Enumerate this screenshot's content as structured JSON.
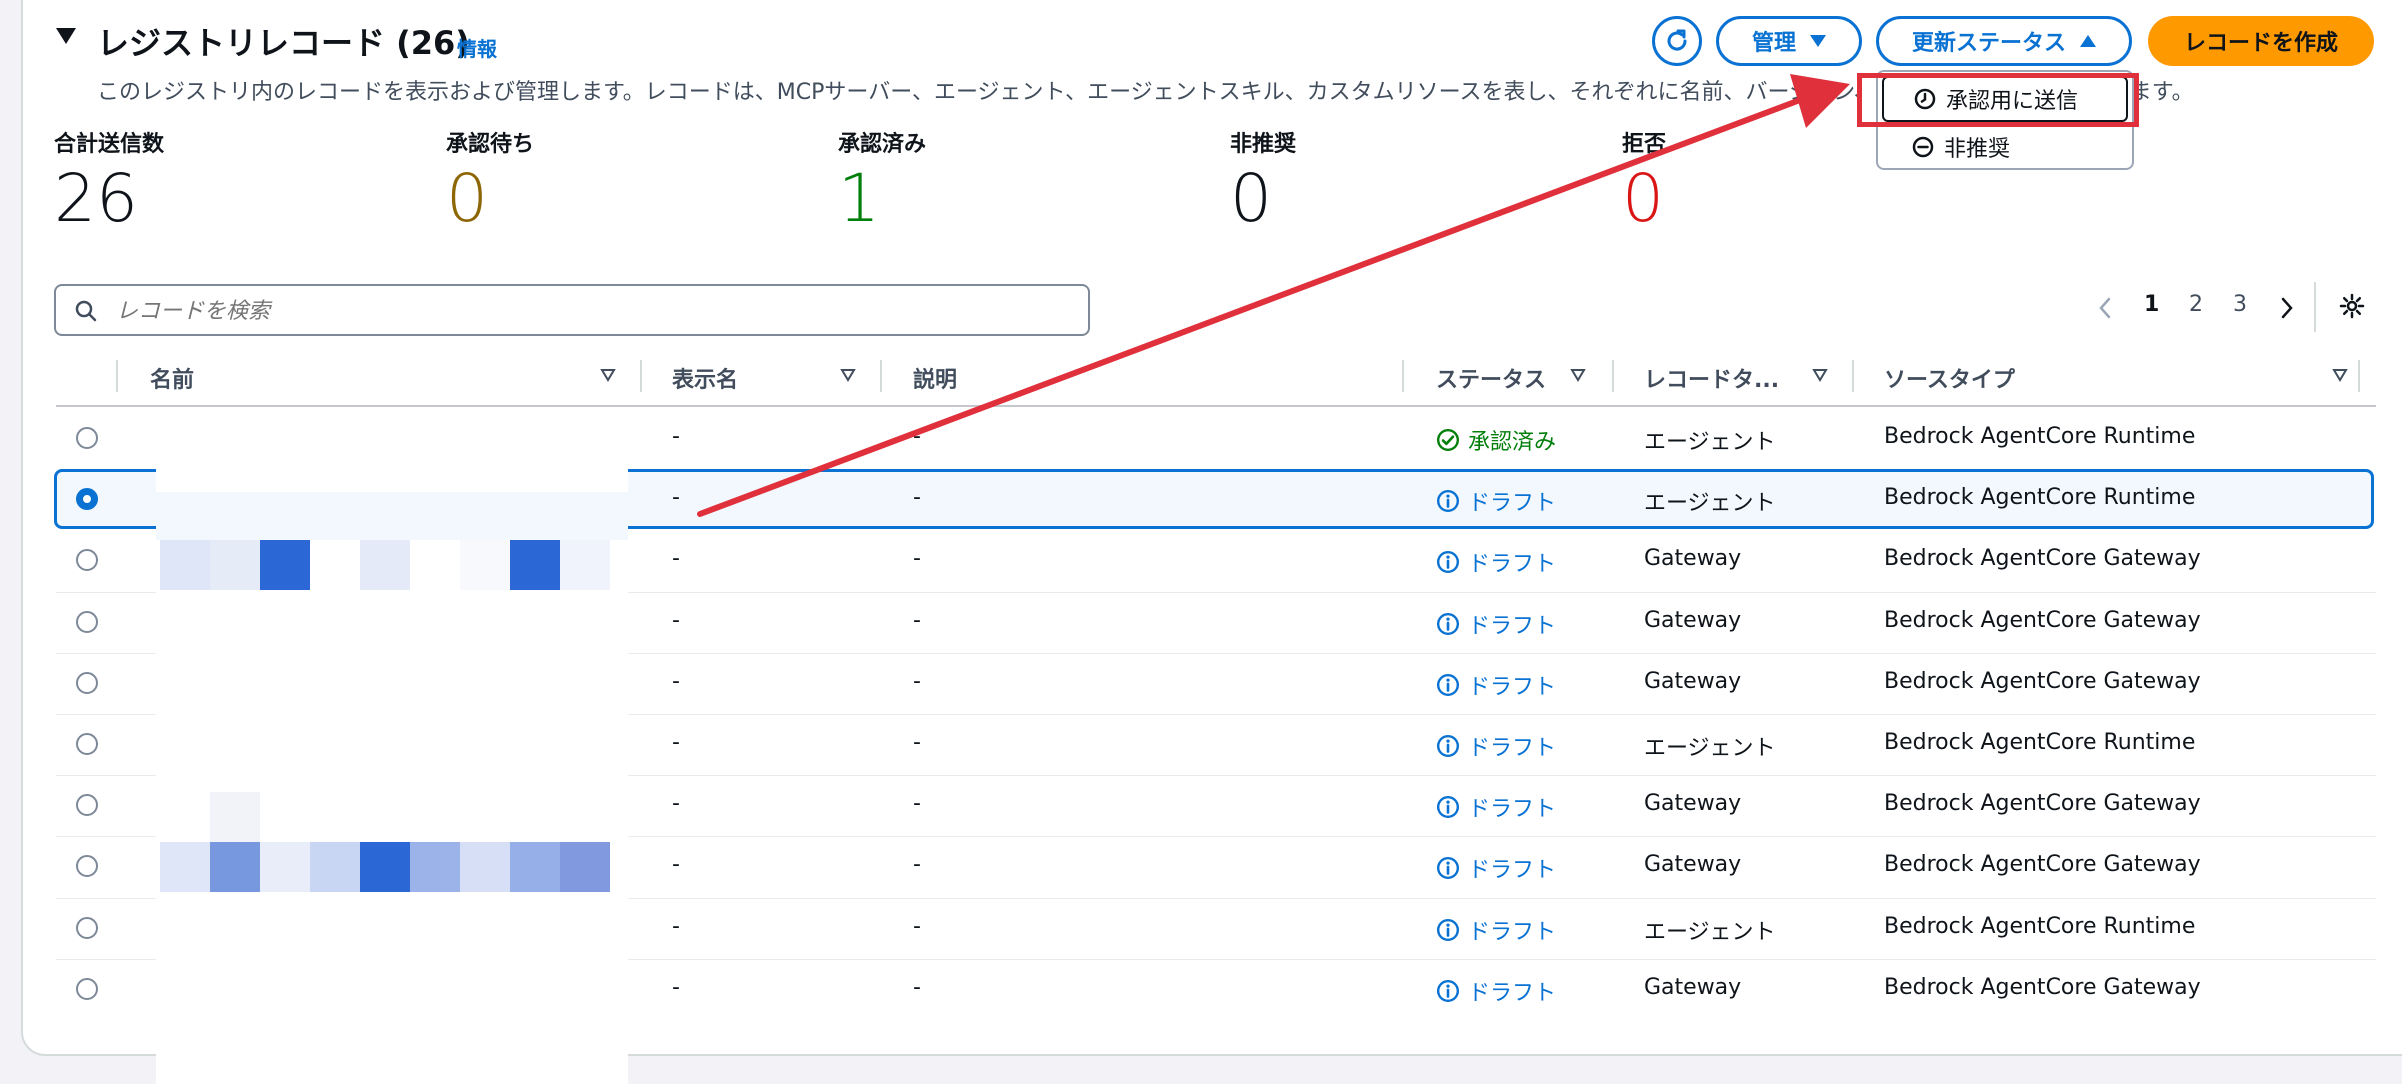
{
  "header": {
    "title": "レジストリレコード (26)",
    "info_link": "情報",
    "description": "このレジストリ内のレコードを表示および管理します。レコードは、MCPサーバー、エージェント、エージェントスキル、カスタムリソースを表し、それぞれに名前、バージョン、",
    "description_tail": "が含まれます。",
    "manage_label": "管理",
    "update_status_label": "更新ステータス",
    "create_label": "レコードを作成"
  },
  "dropdown": {
    "items": [
      {
        "label": "承認用に送信",
        "icon": "clock-icon"
      },
      {
        "label": "非推奨",
        "icon": "minus-circle-icon"
      }
    ]
  },
  "stats": [
    {
      "label": "合計送信数",
      "value": "26",
      "color": "#0f141a"
    },
    {
      "label": "承認待ち",
      "value": "0",
      "color": "#8d6605"
    },
    {
      "label": "承認済み",
      "value": "1",
      "color": "#037f0c"
    },
    {
      "label": "非推奨",
      "value": "0",
      "color": "#0f141a"
    },
    {
      "label": "拒否",
      "value": "0",
      "color": "#d91515"
    }
  ],
  "search": {
    "placeholder": "レコードを検索"
  },
  "pagination": {
    "pages": [
      "1",
      "2",
      "3"
    ],
    "current": "1"
  },
  "table": {
    "columns": [
      "名前",
      "表示名",
      "説明",
      "ステータス",
      "レコードタ...",
      "ソースタイプ"
    ],
    "rows": [
      {
        "display": "-",
        "desc": "-",
        "status": "承認済み",
        "status_kind": "approved",
        "type": "エージェント",
        "source": "Bedrock AgentCore Runtime",
        "selected": false
      },
      {
        "display": "-",
        "desc": "-",
        "status": "ドラフト",
        "status_kind": "draft",
        "type": "エージェント",
        "source": "Bedrock AgentCore Runtime",
        "selected": true
      },
      {
        "display": "-",
        "desc": "-",
        "status": "ドラフト",
        "status_kind": "draft",
        "type": "Gateway",
        "source": "Bedrock AgentCore Gateway",
        "selected": false
      },
      {
        "display": "-",
        "desc": "-",
        "status": "ドラフト",
        "status_kind": "draft",
        "type": "Gateway",
        "source": "Bedrock AgentCore Gateway",
        "selected": false
      },
      {
        "display": "-",
        "desc": "-",
        "status": "ドラフト",
        "status_kind": "draft",
        "type": "Gateway",
        "source": "Bedrock AgentCore Gateway",
        "selected": false
      },
      {
        "display": "-",
        "desc": "-",
        "status": "ドラフト",
        "status_kind": "draft",
        "type": "エージェント",
        "source": "Bedrock AgentCore Runtime",
        "selected": false
      },
      {
        "display": "-",
        "desc": "-",
        "status": "ドラフト",
        "status_kind": "draft",
        "type": "Gateway",
        "source": "Bedrock AgentCore Gateway",
        "selected": false
      },
      {
        "display": "-",
        "desc": "-",
        "status": "ドラフト",
        "status_kind": "draft",
        "type": "Gateway",
        "source": "Bedrock AgentCore Gateway",
        "selected": false
      },
      {
        "display": "-",
        "desc": "-",
        "status": "ドラフト",
        "status_kind": "draft",
        "type": "エージェント",
        "source": "Bedrock AgentCore Runtime",
        "selected": false
      },
      {
        "display": "-",
        "desc": "-",
        "status": "ドラフト",
        "status_kind": "draft",
        "type": "Gateway",
        "source": "Bedrock AgentCore Gateway",
        "selected": false
      }
    ]
  },
  "colors": {
    "accent": "#0972d3",
    "primary": "#ff9900",
    "annotation": "#e0303b"
  }
}
